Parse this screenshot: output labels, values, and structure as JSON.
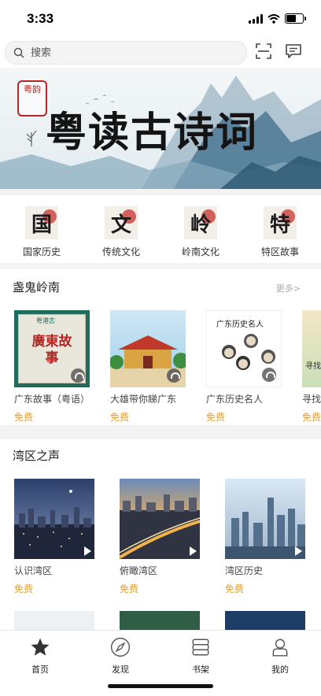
{
  "status": {
    "time": "3:33"
  },
  "header": {
    "search_placeholder": "搜索",
    "scan_icon": "scan-icon",
    "message_icon": "message-icon"
  },
  "banner": {
    "title": "粤读古诗词",
    "seal_text": "粤韵"
  },
  "categories": [
    {
      "label": "国家历史",
      "glyph": "国"
    },
    {
      "label": "传统文化",
      "glyph": "文"
    },
    {
      "label": "岭南文化",
      "glyph": "岭"
    },
    {
      "label": "特区故事",
      "glyph": "特"
    }
  ],
  "section1": {
    "title": "盏鬼岭南",
    "more": "更多>",
    "items": [
      {
        "title": "广东故事（粤语）",
        "price": "免费",
        "cover_text": "廣東故事",
        "cover_tag": "粤港志"
      },
      {
        "title": "大雄带你睇广东",
        "price": "免费"
      },
      {
        "title": "广东历史名人",
        "price": "免费",
        "cover_text": "广东历史名人"
      },
      {
        "title": "寻找",
        "price": "免费",
        "cover_text": "寻找"
      }
    ]
  },
  "section2": {
    "title": "湾区之声",
    "items": [
      {
        "title": "认识湾区",
        "price": "免费"
      },
      {
        "title": "俯瞰湾区",
        "price": "免费"
      },
      {
        "title": "湾区历史",
        "price": "免费"
      }
    ]
  },
  "tabbar": [
    {
      "label": "首页",
      "icon": "star-icon"
    },
    {
      "label": "发现",
      "icon": "compass-icon"
    },
    {
      "label": "书架",
      "icon": "bookshelf-icon"
    },
    {
      "label": "我的",
      "icon": "profile-icon"
    }
  ],
  "colors": {
    "accent": "#e0a23a",
    "seal_red": "#b62623"
  }
}
